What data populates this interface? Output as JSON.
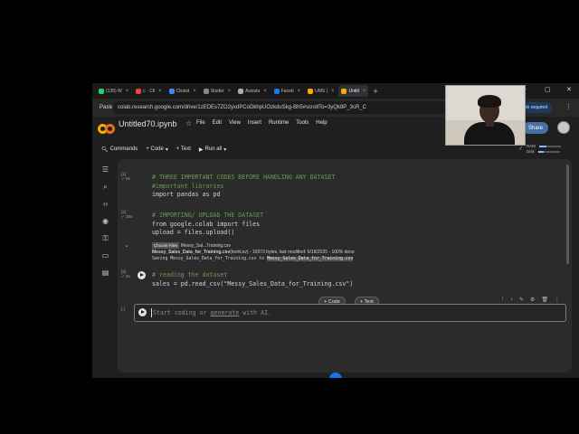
{
  "browser": {
    "tabs": [
      {
        "label": "(135) W",
        "color": "#25d366"
      },
      {
        "label": "c · Cli",
        "color": "#e8453c"
      },
      {
        "label": "Clickst",
        "color": "#4285f4"
      },
      {
        "label": "Studer",
        "color": "#888888"
      },
      {
        "label": "Assista",
        "color": "#aaaaaa"
      },
      {
        "label": "Faceb",
        "color": "#1877f2"
      },
      {
        "label": "UMS |",
        "color": "#f9ab00"
      },
      {
        "label": "Untitl",
        "color": "#f9ab00",
        "active": true
      }
    ],
    "new_tab": "+",
    "paste_label": "Paste",
    "url": "colab.research.google.com/drive/1zEDEs7ZO2yxdPCoDkhpUOzkduSkg-Bh5#scrollTo=3yQk8P_3cR_C",
    "action_required": "Action required"
  },
  "colab": {
    "notebook_title": "Untitled70.ipynb",
    "menu": [
      "File",
      "Edit",
      "View",
      "Insert",
      "Runtime",
      "Tools",
      "Help"
    ],
    "share_label": "Share",
    "toolbar": {
      "commands": "Commands",
      "code": "+ Code",
      "text": "+ Text",
      "run_all": "Run all"
    },
    "ram_label": "RAM",
    "disk_label": "Disk",
    "ram_fill": 0.35,
    "disk_fill": 0.25
  },
  "cells": [
    {
      "num": "[1]",
      "status": "0s",
      "lines": [
        "# THREE IMPORTANT CODES BEFORE HANDLING ANY DATASET",
        "#important libraries",
        "import pandas as pd"
      ]
    },
    {
      "num": "[2]",
      "status": "38s",
      "lines": [
        "# IMPORTING/ UPLOAD THE DATASET",
        "from google.colab import files",
        "upload = files.upload()"
      ],
      "output": {
        "choose_btn": "Choose Files",
        "chosen_file": "Messy_Sal...Training.csv",
        "file_bold": "Messy_Sales_Data_for_Training.csv",
        "file_meta": "(text/csv) - 19973 bytes, last modified: 6/18/2025 - 100% done",
        "saving_prefix": "Saving Messy_Sales_Data_for_Training.csv to ",
        "saving_target": "Messy_Sales_Data_for_Training.csv"
      }
    },
    {
      "num": "[3]",
      "status": "0s",
      "lines": [
        "# reading the dataset",
        "sales = pd.read_csv(\"Messy_Sales_Data_for_Training.csv\")"
      ]
    }
  ],
  "active_cell": {
    "num": "[ ]",
    "placeholder_start": "Start coding or ",
    "placeholder_link": "generate",
    "placeholder_end": " with AI."
  },
  "add_code": "+ Code",
  "add_text": "+ Text"
}
